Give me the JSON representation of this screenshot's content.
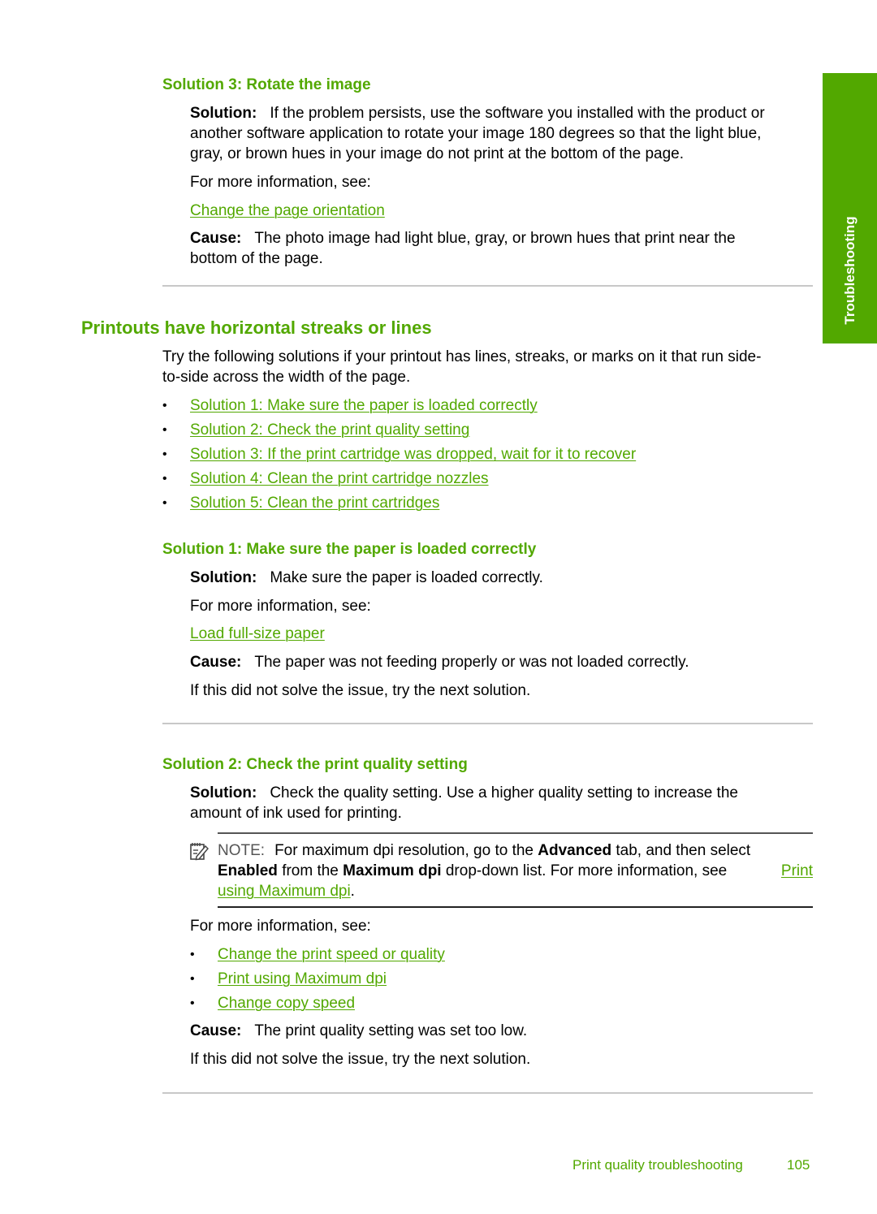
{
  "side_tab": {
    "label": "Troubleshooting",
    "color": "#52a800"
  },
  "section_rotate": {
    "heading": "Solution 3: Rotate the image",
    "solution_label": "Solution:",
    "solution_line1": "If the problem persists, use the software you installed with the product or",
    "solution_line2": "another software application to rotate your image 180 degrees so that the light blue,",
    "solution_line3": "gray, or brown hues in your image do not print at the bottom of the page.",
    "more_info": "For more information, see:",
    "link": "Change the page orientation",
    "cause_label": "Cause:",
    "cause_line1": "The photo image had light blue, gray, or brown hues that print near the",
    "cause_line2": "bottom of the page."
  },
  "section_streaks": {
    "heading": "Printouts have horizontal streaks or lines",
    "intro_line1": "Try the following solutions if your printout has lines, streaks, or marks on it that run side-",
    "intro_line2": "to-side across the width of the page.",
    "links": [
      "Solution 1: Make sure the paper is loaded correctly",
      "Solution 2: Check the print quality setting",
      "Solution 3: If the print cartridge was dropped, wait for it to recover",
      "Solution 4: Clean the print cartridge nozzles",
      "Solution 5: Clean the print cartridges"
    ],
    "bullet": "•"
  },
  "section_sol1": {
    "heading": "Solution 1: Make sure the paper is loaded correctly",
    "solution_label": "Solution:",
    "solution_text": "Make sure the paper is loaded correctly.",
    "more_info": "For more information, see:",
    "link": "Load full-size paper",
    "cause_label": "Cause:",
    "cause_text": "The paper was not feeding properly or was not loaded correctly.",
    "next": "If this did not solve the issue, try the next solution."
  },
  "section_sol2": {
    "heading": "Solution 2: Check the print quality setting",
    "solution_label": "Solution:",
    "solution_line1": "Check the quality setting. Use a higher quality setting to increase the",
    "solution_line2": "amount of ink used for printing.",
    "note": {
      "label": "NOTE:",
      "t1": "For maximum dpi resolution, go to the",
      "b1": "Advanced",
      "t2": "tab, and then select",
      "b2": "Enabled",
      "t3": "from the",
      "b3": "Maximum dpi",
      "t4": "drop-down list. For more information, see",
      "link_part1": "Print",
      "link_part2": "using Maximum dpi",
      "end": "."
    },
    "more_info": "For more information, see:",
    "links": [
      "Change the print speed or quality",
      "Print using Maximum dpi",
      "Change copy speed"
    ],
    "bullet": "•",
    "cause_label": "Cause:",
    "cause_text": "The print quality setting was set too low.",
    "next": "If this did not solve the issue, try the next solution."
  },
  "footer": {
    "section": "Print quality troubleshooting",
    "page_number": "105"
  }
}
